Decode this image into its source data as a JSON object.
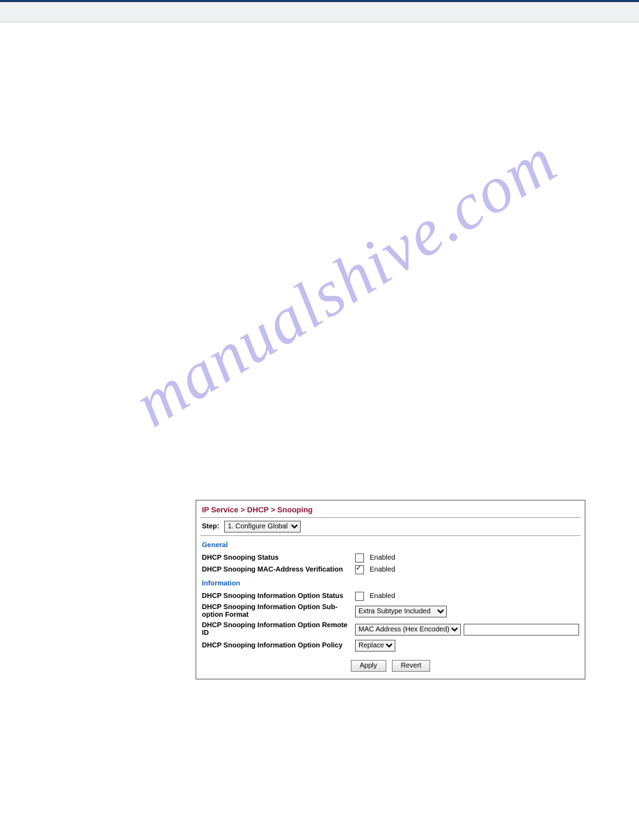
{
  "watermark": "manualshive.com",
  "breadcrumb": "IP Service > DHCP > Snooping",
  "step": {
    "label": "Step:",
    "selected": "1. Configure Global"
  },
  "sections": {
    "general": {
      "title": "General",
      "rows": [
        {
          "label": "DHCP Snooping Status",
          "checkbox_text": "Enabled",
          "checked": false
        },
        {
          "label": "DHCP Snooping MAC-Address Verification",
          "checkbox_text": "Enabled",
          "checked": true
        }
      ]
    },
    "information": {
      "title": "Information",
      "status": {
        "label": "DHCP Snooping Information Option Status",
        "checkbox_text": "Enabled",
        "checked": false
      },
      "suboption": {
        "label": "DHCP Snooping Information Option Sub-option Format",
        "selected": "Extra Subtype Included"
      },
      "remote": {
        "label": "DHCP Snooping Information Option Remote ID",
        "selected": "MAC Address (Hex Encoded)",
        "input_value": ""
      },
      "policy": {
        "label": "DHCP Snooping Information Option Policy",
        "selected": "Replace"
      }
    }
  },
  "buttons": {
    "apply": "Apply",
    "revert": "Revert"
  }
}
